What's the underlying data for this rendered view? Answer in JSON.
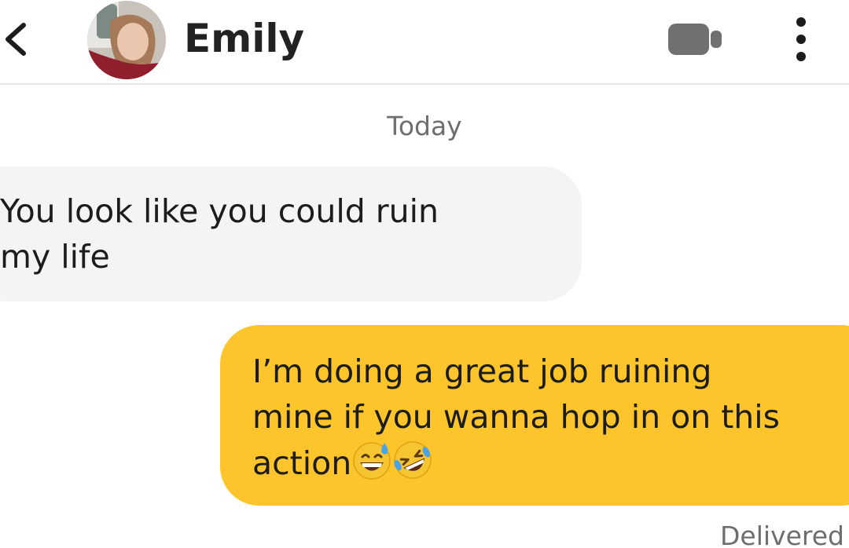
{
  "header": {
    "back_icon": "chevron-left-icon",
    "contact_name": "Emily",
    "video_icon": "video-camera-icon",
    "more_icon": "more-vertical-icon"
  },
  "conversation": {
    "date_label": "Today",
    "messages": [
      {
        "direction": "incoming",
        "text": "You look like you could ruin\nmy life"
      },
      {
        "direction": "outgoing",
        "text": "I’m doing a great job ruining\nmine if you wanna hop in on this\naction",
        "emojis": [
          "grinning-sweat-emoji",
          "rolling-on-floor-laughing-emoji"
        ]
      }
    ],
    "status": "Delivered"
  },
  "colors": {
    "outgoing_bubble": "#fdc52b",
    "incoming_bubble": "#f4f4f4",
    "icon_gray": "#707070"
  }
}
